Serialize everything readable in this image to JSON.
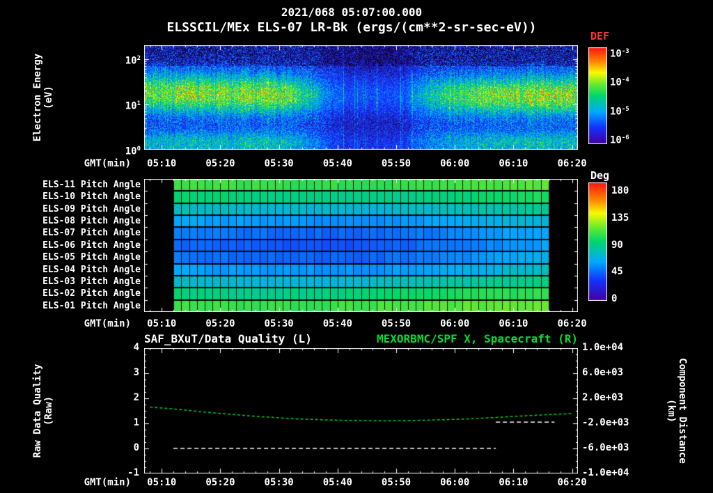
{
  "header": {
    "date_line": "2021/068 05:07:00.000",
    "title": "ELSSCIL/MEx ELS-07 LR-Bk (ergs/(cm**2-sr-sec-eV))"
  },
  "time_axis": {
    "label": "GMT(min)",
    "start": "05:07",
    "end": "06:21",
    "tick_labels": [
      "05:10",
      "05:20",
      "05:30",
      "05:40",
      "05:50",
      "06:00",
      "06:10",
      "06:20"
    ]
  },
  "colors": {
    "background": "#000000",
    "text": "#ffffff",
    "accent_green": "#00dd33",
    "accent_red": "#ff3333",
    "pitch_grid": "#3f0e0e"
  },
  "chart_data": [
    {
      "type": "heatmap",
      "name": "electron-energy-spectrogram",
      "ylabel_lines": [
        "Electron Energy",
        "(eV)"
      ],
      "yscale": "log",
      "ylim_ev": [
        1,
        200
      ],
      "yticks": [
        {
          "exp": 0
        },
        {
          "exp": 1
        },
        {
          "exp": 2
        }
      ],
      "xlabel": "GMT(min)",
      "colorbar": {
        "label": "DEF",
        "units": "ergs/(cm**2-sr-sec-eV)",
        "scale": "log",
        "ticks": [
          {
            "exp": -3
          },
          {
            "exp": -4
          },
          {
            "exp": -5
          },
          {
            "exp": -6
          }
        ]
      },
      "features": {
        "summary": "Enhanced electron flux band ~5-40 eV; flux dropout ~05:38-05:52; strong flux after 06:05",
        "band_center_log_ev": 1.2,
        "band_sigma_log": 0.3,
        "low_band_center_log_ev": 0.15,
        "dropout": {
          "start": "05:38",
          "end": "05:52"
        },
        "envelope": [
          [
            0,
            1.0
          ],
          [
            0.26,
            1.0
          ],
          [
            0.31,
            1.1
          ],
          [
            0.36,
            0.8
          ],
          [
            0.42,
            0.35
          ],
          [
            0.47,
            0.18
          ],
          [
            0.6,
            0.2
          ],
          [
            0.65,
            0.55
          ],
          [
            0.72,
            0.85
          ],
          [
            0.8,
            1.0
          ],
          [
            1,
            1.05
          ]
        ],
        "seed": 1337
      }
    },
    {
      "type": "heatmap",
      "name": "pitch-angle-panel",
      "data_start": "05:12",
      "data_end": "06:16",
      "grid_columns": 48,
      "seed": 77,
      "colorbar": {
        "label": "Deg",
        "min": 0,
        "max": 180,
        "ticks": [
          180,
          135,
          90,
          45,
          0
        ]
      },
      "rows": [
        {
          "label": "ELS-11 Pitch Angle",
          "values": [
            103,
            100,
            99,
            102,
            108
          ]
        },
        {
          "label": "ELS-10 Pitch Angle",
          "values": [
            90,
            86,
            84,
            88,
            95
          ]
        },
        {
          "label": "ELS-09 Pitch Angle",
          "values": [
            75,
            70,
            68,
            74,
            82
          ]
        },
        {
          "label": "ELS-08 Pitch Angle",
          "values": [
            60,
            55,
            52,
            60,
            70
          ]
        },
        {
          "label": "ELS-07 Pitch Angle",
          "values": [
            50,
            45,
            42,
            50,
            62
          ]
        },
        {
          "label": "ELS-06 Pitch Angle",
          "values": [
            44,
            40,
            38,
            47,
            58
          ]
        },
        {
          "label": "ELS-05 Pitch Angle",
          "values": [
            47,
            43,
            42,
            51,
            63
          ]
        },
        {
          "label": "ELS-04 Pitch Angle",
          "values": [
            58,
            54,
            54,
            62,
            72
          ]
        },
        {
          "label": "ELS-03 Pitch Angle",
          "values": [
            72,
            68,
            70,
            78,
            86
          ]
        },
        {
          "label": "ELS-02 Pitch Angle",
          "values": [
            88,
            84,
            87,
            94,
            100
          ]
        },
        {
          "label": "ELS-01 Pitch Angle",
          "values": [
            102,
            99,
            102,
            107,
            112
          ]
        }
      ]
    },
    {
      "type": "line",
      "name": "quality-distance-panel",
      "title_left": {
        "text": "SAF_BXuT/Data Quality (L)",
        "color": "#ffffff"
      },
      "title_right": {
        "text": "MEXORBMC/SPF X, Spacecraft (R)",
        "color": "#00dd33"
      },
      "left_axis": {
        "label_lines": [
          "Raw Data Quality",
          "(Raw)"
        ],
        "lim": [
          -1,
          4
        ],
        "ticks": [
          4,
          3,
          2,
          1,
          0,
          -1
        ]
      },
      "right_axis": {
        "label_lines": [
          "Component Distance",
          "(km)"
        ],
        "lim": [
          -10000,
          10000
        ],
        "ticks": [
          "1.0e+04",
          "6.0e+03",
          "2.0e+03",
          "-2.0e+03",
          "-6.0e+03",
          "-1.0e+04"
        ]
      },
      "series": [
        {
          "name": "MEXORBMC/SPF X Spacecraft distance",
          "axis": "right",
          "color": "#00cc33",
          "dash": [
            4,
            3
          ],
          "points": [
            [
              "05:08",
              600
            ],
            [
              "05:12",
              300
            ],
            [
              "05:18",
              -250
            ],
            [
              "05:25",
              -800
            ],
            [
              "05:32",
              -1250
            ],
            [
              "05:40",
              -1500
            ],
            [
              "05:48",
              -1600
            ],
            [
              "05:55",
              -1500
            ],
            [
              "06:02",
              -1300
            ],
            [
              "06:08",
              -1000
            ],
            [
              "06:14",
              -700
            ],
            [
              "06:20",
              -420
            ]
          ]
        },
        {
          "name": "SAF_BXuT Data Quality",
          "axis": "left",
          "color": "#ffffff",
          "dash": [
            6,
            4
          ],
          "segments": [
            {
              "value": 0,
              "start": "05:12",
              "end": "06:07"
            },
            {
              "value": 1.05,
              "start": "06:07",
              "end": "06:17"
            }
          ]
        }
      ]
    }
  ]
}
